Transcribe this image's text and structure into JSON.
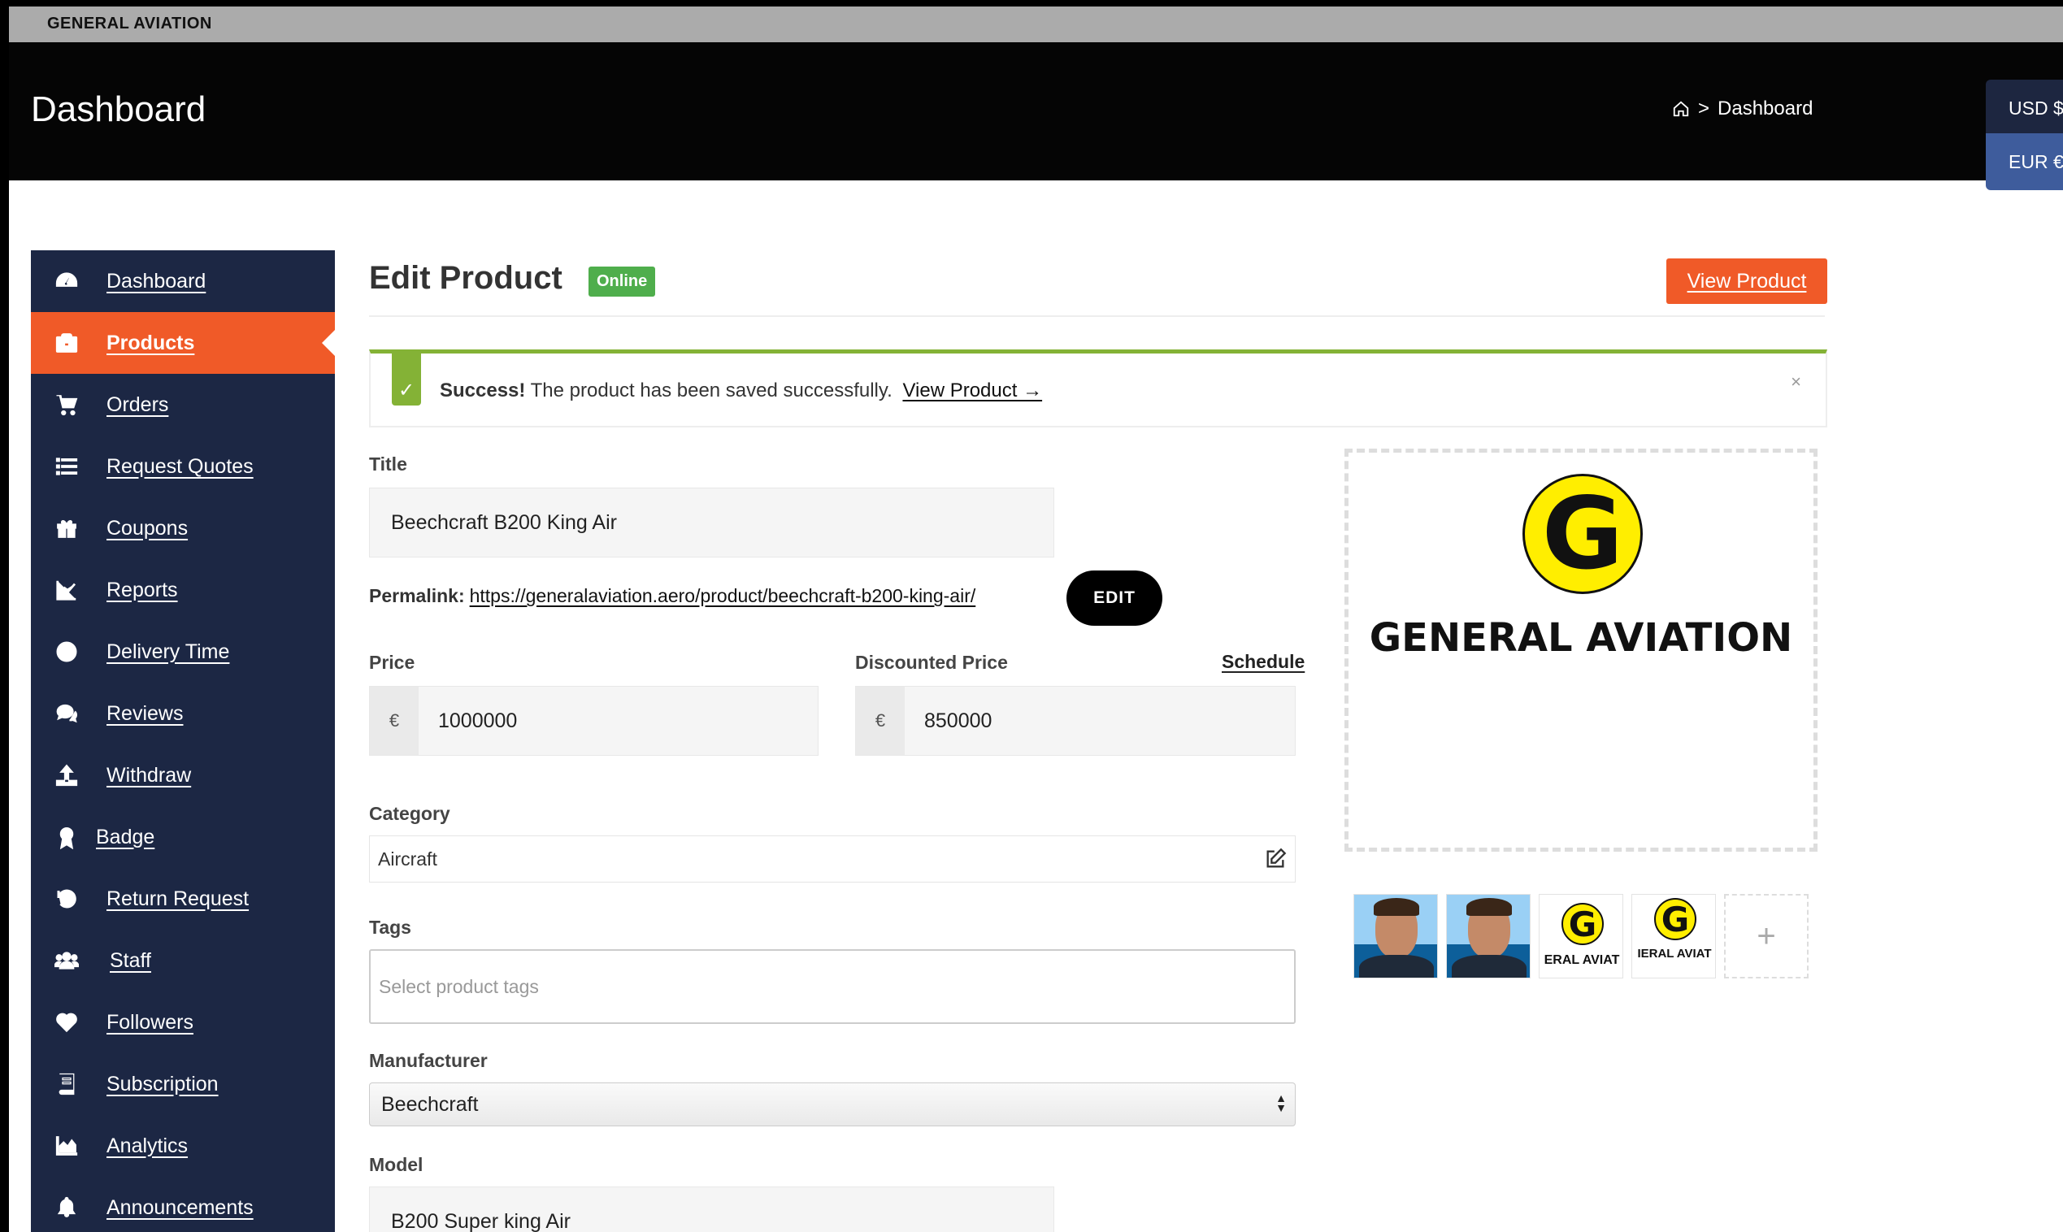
{
  "topbar": {
    "brand": "GENERAL AVIATION"
  },
  "header": {
    "title": "Dashboard",
    "breadcrumb": {
      "separator": ">",
      "current": "Dashboard"
    }
  },
  "currency": {
    "usd": "USD $",
    "eur": "EUR €"
  },
  "sidebar": {
    "items": [
      {
        "label": "Dashboard",
        "icon": "tachometer-icon"
      },
      {
        "label": "Products",
        "icon": "briefcase-icon",
        "active": true
      },
      {
        "label": "Orders",
        "icon": "shopping-cart-icon"
      },
      {
        "label": "Request Quotes",
        "icon": "list-icon"
      },
      {
        "label": "Coupons",
        "icon": "gift-icon"
      },
      {
        "label": "Reports",
        "icon": "line-chart-icon"
      },
      {
        "label": "Delivery Time",
        "icon": "clock-icon"
      },
      {
        "label": "Reviews",
        "icon": "comments-icon"
      },
      {
        "label": "Withdraw",
        "icon": "upload-icon"
      },
      {
        "label": "Badge",
        "icon": "award-icon"
      },
      {
        "label": "Return Request",
        "icon": "undo-icon"
      },
      {
        "label": "Staff",
        "icon": "users-icon"
      },
      {
        "label": "Followers",
        "icon": "heart-icon"
      },
      {
        "label": "Subscription",
        "icon": "book-icon"
      },
      {
        "label": "Analytics",
        "icon": "area-chart-icon"
      },
      {
        "label": "Announcements",
        "icon": "bell-icon"
      }
    ]
  },
  "main": {
    "title": "Edit Product",
    "status_badge": "Online",
    "view_product_label": "View Product",
    "alert": {
      "strong": "Success!",
      "message": "The product has been saved successfully.",
      "link": "View Product →",
      "close": "×",
      "check": "✓"
    },
    "title_label": "Title",
    "title_value": "Beechcraft B200 King Air",
    "permalink_label": "Permalink:",
    "permalink_url": "https://generalaviation.aero/product/beechcraft-b200-king-air/",
    "edit_label": "EDIT",
    "price_label": "Price",
    "price_symbol": "€",
    "price_value": "1000000",
    "discount_label": "Discounted Price",
    "schedule_label": "Schedule",
    "discount_symbol": "€",
    "discount_value": "850000",
    "category_label": "Category",
    "category_value": "Aircraft",
    "tags_label": "Tags",
    "tags_placeholder": "Select product tags",
    "manufacturer_label": "Manufacturer",
    "manufacturer_value": "Beechcraft",
    "model_label": "Model",
    "model_value": "B200 Super king Air"
  },
  "featured_image": {
    "logo_letter": "G",
    "logo_text": "GENERAL AVIATION"
  },
  "gallery": {
    "thumb3_text": "ERAL AVIAT",
    "thumb4_text": "IERAL AVIAT",
    "logo_letter": "G",
    "add_label": "+"
  },
  "colors": {
    "accent": "#f05a28",
    "sidebar": "#1c2744",
    "success": "#84b236",
    "badge": "#4fae4c"
  }
}
